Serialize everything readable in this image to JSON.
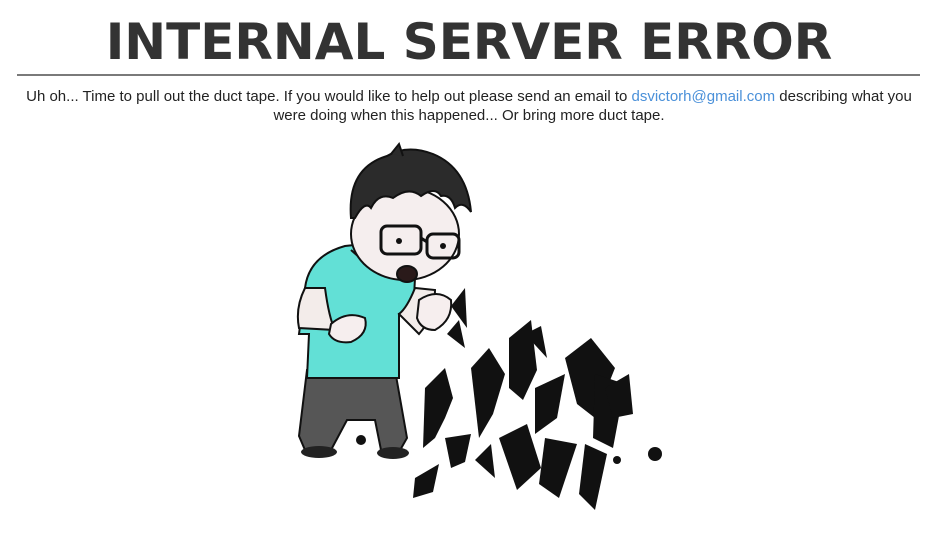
{
  "page": {
    "title": "INTERNAL SERVER ERROR",
    "message_before_link": "Uh oh... Time to pull out the duct tape. If you would like to help out please send an email to ",
    "email_link": "dsvictorh@gmail.com",
    "message_after_link": " describing what you were doing when this happened... Or bring more duct tape."
  },
  "illustration": {
    "description_icon": "broken-computer-character-icon",
    "shirt_color": "#5fe0d8",
    "pants_color": "#555555",
    "hair_color": "#2a2a2a"
  }
}
